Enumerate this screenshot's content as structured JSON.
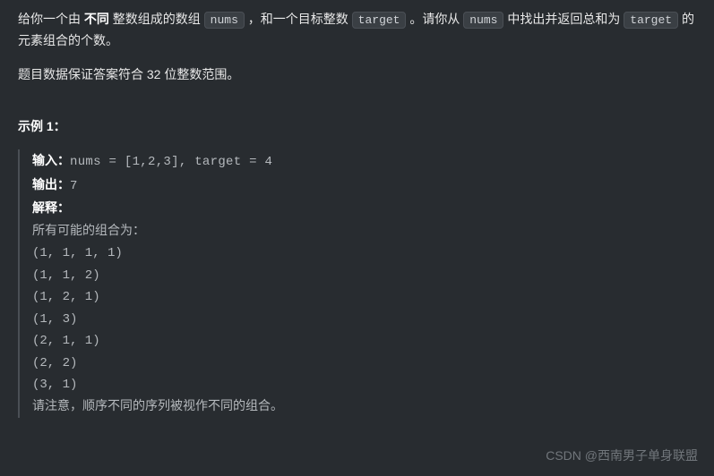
{
  "desc": {
    "p1_a": "给你一个由 ",
    "p1_bold": "不同 ",
    "p1_b": "整数组成的数组 ",
    "code_nums": "nums",
    "p1_c": " ，和一个目标整数 ",
    "code_target": "target",
    "p1_d": " 。请你从 ",
    "p1_e": " 中找出并返回总和为 ",
    "p1_f": " 的元素组合的个数。",
    "p2": "题目数据保证答案符合 32 位整数范围。"
  },
  "example_title": "示例 1：",
  "example": {
    "input_label": "输入：",
    "input_value": "nums = [1,2,3], target = 4",
    "output_label": "输出：",
    "output_value": "7",
    "explain_label": "解释：",
    "explain_intro": "所有可能的组合为：",
    "combos": [
      "(1, 1, 1, 1)",
      "(1, 1, 2)",
      "(1, 2, 1)",
      "(1, 3)",
      "(2, 1, 1)",
      "(2, 2)",
      "(3, 1)"
    ],
    "note": "请注意，顺序不同的序列被视作不同的组合。"
  },
  "watermark": "CSDN @西南男子单身联盟"
}
